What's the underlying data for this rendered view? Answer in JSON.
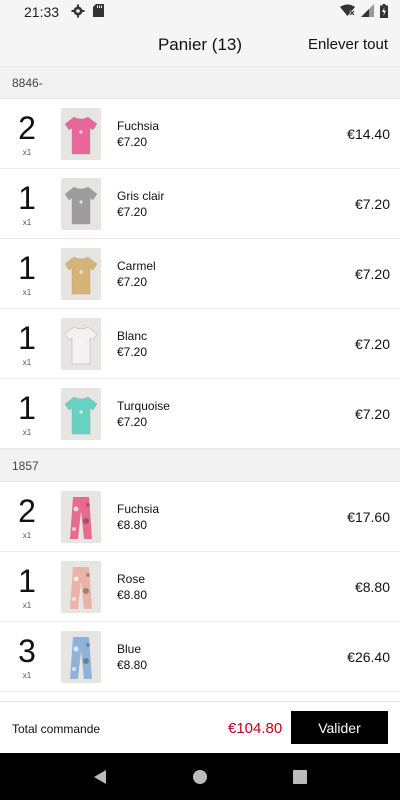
{
  "status_bar": {
    "time": "21:33",
    "left_icons": [
      "settings-gear-icon",
      "sd-card-icon"
    ],
    "right_icons": [
      "wifi-off-icon",
      "cell-signal-icon",
      "battery-charging-icon"
    ]
  },
  "app_bar": {
    "title": "Panier (13)",
    "remove_all_label": "Enlever tout"
  },
  "sections": [
    {
      "header": "8846-",
      "items": [
        {
          "qty": "2",
          "qty_sub": "x1",
          "name": "Fuchsia",
          "unit_price": "€7.20",
          "total": "€14.40",
          "color": "#e8669a"
        },
        {
          "qty": "1",
          "qty_sub": "x1",
          "name": "Gris clair",
          "unit_price": "€7.20",
          "total": "€7.20",
          "color": "#9d9d9d"
        },
        {
          "qty": "1",
          "qty_sub": "x1",
          "name": "Carmel",
          "unit_price": "€7.20",
          "total": "€7.20",
          "color": "#d6b376"
        },
        {
          "qty": "1",
          "qty_sub": "x1",
          "name": "Blanc",
          "unit_price": "€7.20",
          "total": "€7.20",
          "color": "#f2f2f2"
        },
        {
          "qty": "1",
          "qty_sub": "x1",
          "name": "Turquoise",
          "unit_price": "€7.20",
          "total": "€7.20",
          "color": "#66d3c2"
        }
      ]
    },
    {
      "header": "1857",
      "items": [
        {
          "qty": "2",
          "qty_sub": "x1",
          "name": "Fuchsia",
          "unit_price": "€8.80",
          "total": "€17.60",
          "color": "#e56b8f"
        },
        {
          "qty": "1",
          "qty_sub": "x1",
          "name": "Rose",
          "unit_price": "€8.80",
          "total": "€8.80",
          "color": "#e9b3a6"
        },
        {
          "qty": "3",
          "qty_sub": "x1",
          "name": "Blue",
          "unit_price": "€8.80",
          "total": "€26.40",
          "color": "#8fb3d8"
        }
      ]
    }
  ],
  "footer": {
    "label": "Total commande",
    "amount": "€104.80",
    "validate_label": "Valider",
    "amount_color": "#c00018"
  },
  "nav_bar": {
    "icons": [
      "back-icon",
      "home-icon",
      "recents-icon"
    ]
  }
}
